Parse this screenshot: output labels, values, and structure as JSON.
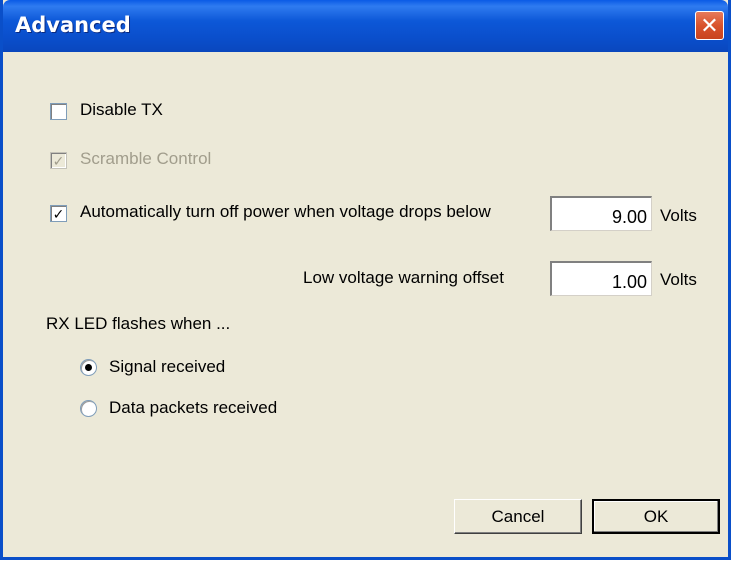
{
  "window": {
    "title": "Advanced",
    "close_label": "✕"
  },
  "options": {
    "disable_tx": {
      "label": "Disable TX",
      "checked": false
    },
    "scramble_control": {
      "label": "Scramble Control",
      "checked": true,
      "enabled": false
    },
    "auto_power_off": {
      "label": "Automatically turn off power when voltage drops below",
      "checked": true,
      "value": "9.00",
      "unit": "Volts"
    },
    "low_voltage_offset": {
      "label": "Low voltage warning offset",
      "value": "1.00",
      "unit": "Volts"
    }
  },
  "rx_led": {
    "heading": "RX LED flashes when ...",
    "choices": [
      {
        "label": "Signal received",
        "selected": true
      },
      {
        "label": "Data packets received",
        "selected": false
      }
    ]
  },
  "buttons": {
    "cancel": "Cancel",
    "ok": "OK"
  }
}
